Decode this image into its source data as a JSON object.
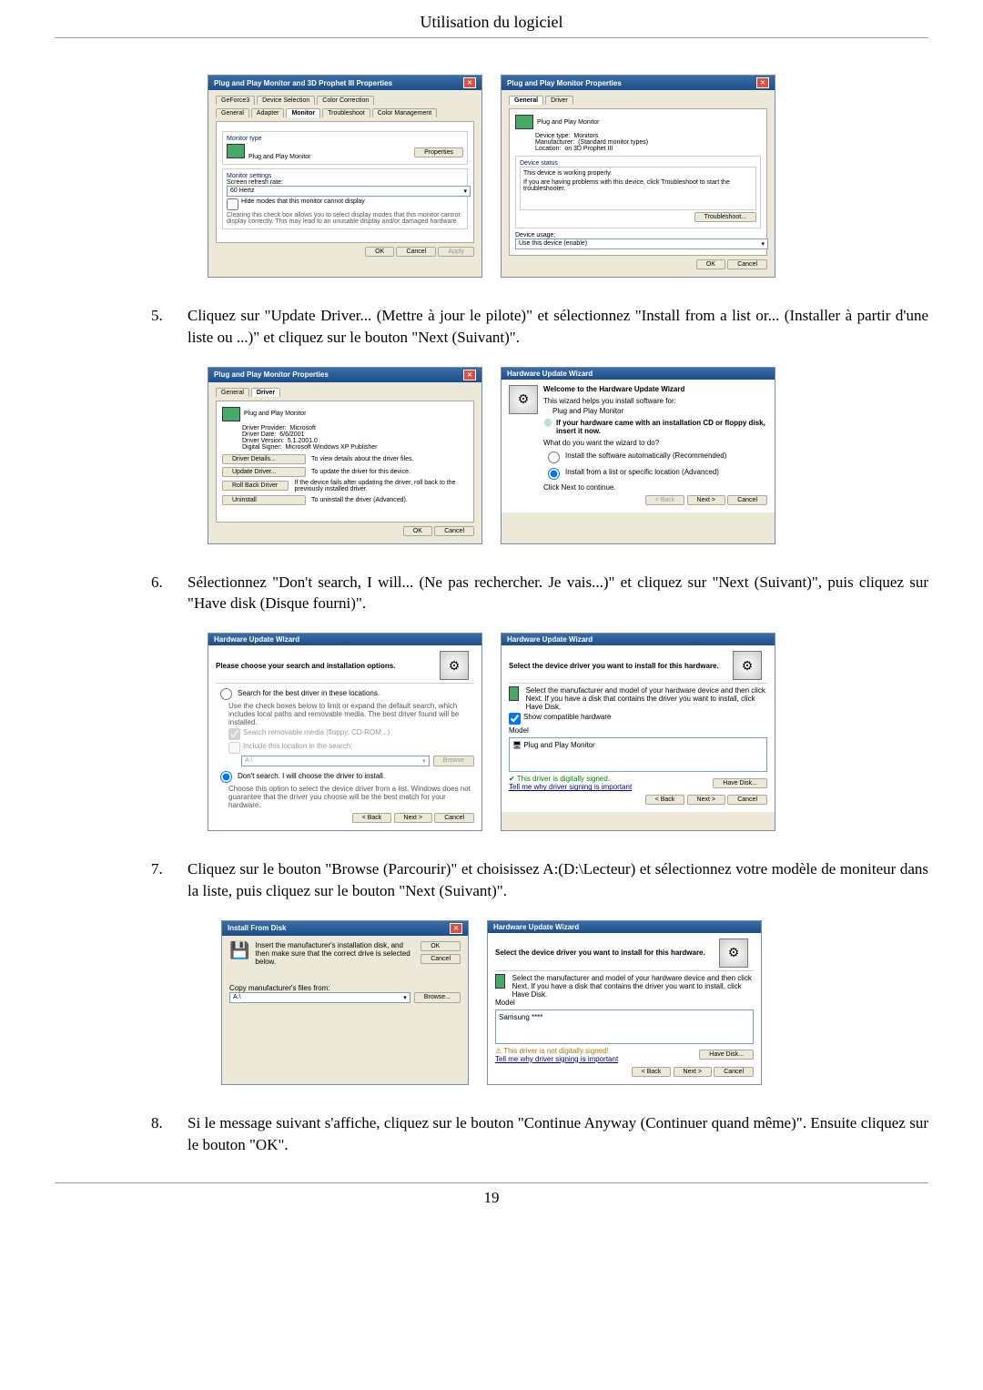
{
  "header": "Utilisation du logiciel",
  "page_number": "19",
  "steps": {
    "s5": {
      "num": "5.",
      "text": "Cliquez sur \"Update Driver... (Mettre à jour le pilote)\" et sélectionnez \"Install from a list or... (Installer à partir d'une liste ou ...)\" et cliquez sur le bouton \"Next (Suivant)\"."
    },
    "s6": {
      "num": "6.",
      "text": "Sélectionnez \"Don't search, I will... (Ne pas rechercher. Je vais...)\" et cliquez sur \"Next (Suivant)\", puis cliquez sur \"Have disk (Disque fourni)\"."
    },
    "s7": {
      "num": "7.",
      "text": "Cliquez sur le bouton \"Browse (Parcourir)\" et choisissez A:(D:\\Lecteur) et sélectionnez votre modèle de moniteur dans la liste, puis cliquez sur le bouton \"Next (Suivant)\"."
    },
    "s8": {
      "num": "8.",
      "text": "Si le message suivant s'affiche, cliquez sur le bouton \"Continue Anyway (Continuer quand même)\". Ensuite cliquez sur le bouton \"OK\"."
    }
  },
  "d1": {
    "title": "Plug and Play Monitor and 3D Prophet III Properties",
    "tabs": {
      "t1": "GeForce3",
      "t2": "Device Selection",
      "t3": "Color Correction",
      "t4": "General",
      "t5": "Adapter",
      "t6": "Monitor",
      "t7": "Troubleshoot",
      "t8": "Color Management"
    },
    "mon_type_lbl": "Monitor type",
    "mon_type": "Plug and Play Monitor",
    "prop_btn": "Properties",
    "mon_set_lbl": "Monitor settings",
    "refresh_lbl": "Screen refresh rate:",
    "refresh_val": "60 Hertz",
    "hide_modes": "Hide modes that this monitor cannot display",
    "hide_desc": "Clearing this check box allows you to select display modes that this monitor cannot display correctly. This may lead to an unusable display and/or damaged hardware.",
    "ok": "OK",
    "cancel": "Cancel",
    "apply": "Apply"
  },
  "d2": {
    "title": "Plug and Play Monitor Properties",
    "tabs": {
      "t1": "General",
      "t2": "Driver"
    },
    "name": "Plug and Play Monitor",
    "devtype_lbl": "Device type:",
    "devtype": "Monitors",
    "manuf_lbl": "Manufacturer:",
    "manuf": "(Standard monitor types)",
    "loc_lbl": "Location:",
    "loc": "on 3D Prophet III",
    "status_lbl": "Device status",
    "status_text": "This device is working properly.",
    "status_text2": "If you are having problems with this device, click Troubleshoot to start the troubleshooter.",
    "trouble_btn": "Troubleshoot...",
    "usage_lbl": "Device usage:",
    "usage_val": "Use this device (enable)",
    "ok": "OK",
    "cancel": "Cancel"
  },
  "d3": {
    "title": "Plug and Play Monitor Properties",
    "tabs": {
      "t1": "General",
      "t2": "Driver"
    },
    "name": "Plug and Play Monitor",
    "prov_lbl": "Driver Provider:",
    "prov": "Microsoft",
    "date_lbl": "Driver Date:",
    "date": "6/6/2001",
    "ver_lbl": "Driver Version:",
    "ver": "5.1.2001.0",
    "sign_lbl": "Digital Signer:",
    "sign": "Microsoft Windows XP Publisher",
    "details_btn": "Driver Details...",
    "details_desc": "To view details about the driver files.",
    "update_btn": "Update Driver...",
    "update_desc": "To update the driver for this device.",
    "roll_btn": "Roll Back Driver",
    "roll_desc": "If the device fails after updating the driver, roll back to the previously installed driver.",
    "unin_btn": "Uninstall",
    "unin_desc": "To uninstall the driver (Advanced).",
    "ok": "OK",
    "cancel": "Cancel"
  },
  "d4": {
    "title": "Hardware Update Wizard",
    "h1": "Welcome to the Hardware Update Wizard",
    "line1": "This wizard helps you install software for:",
    "line2": "Plug and Play Monitor",
    "cd_text": "If your hardware came with an installation CD or floppy disk, insert it now.",
    "q": "What do you want the wizard to do?",
    "opt1": "Install the software automatically (Recommended)",
    "opt2": "Install from a list or specific location (Advanced)",
    "cont": "Click Next to continue.",
    "back": "< Back",
    "next": "Next >",
    "cancel": "Cancel"
  },
  "d5": {
    "title": "Hardware Update Wizard",
    "h": "Please choose your search and installation options.",
    "opt1": "Search for the best driver in these locations.",
    "opt1_desc": "Use the check boxes below to limit or expand the default search, which includes local paths and removable media. The best driver found will be installed.",
    "cb1": "Search removable media (floppy, CD-ROM...)",
    "cb2": "Include this location in the search:",
    "path": "A:\\",
    "browse": "Browse",
    "opt2": "Don't search. I will choose the driver to install.",
    "opt2_desc": "Choose this option to select the device driver from a list. Windows does not guarantee that the driver you choose will be the best match for your hardware.",
    "back": "< Back",
    "next": "Next >",
    "cancel": "Cancel"
  },
  "d6": {
    "title": "Hardware Update Wizard",
    "h": "Select the device driver you want to install for this hardware.",
    "desc": "Select the manufacturer and model of your hardware device and then click Next. If you have a disk that contains the driver you want to install, click Have Disk.",
    "compat": "Show compatible hardware",
    "model_lbl": "Model",
    "model": "Plug and Play Monitor",
    "signed": "This driver is digitally signed.",
    "tell": "Tell me why driver signing is important",
    "have": "Have Disk...",
    "back": "< Back",
    "next": "Next >",
    "cancel": "Cancel"
  },
  "d7": {
    "title": "Install From Disk",
    "desc": "Insert the manufacturer's installation disk, and then make sure that the correct drive is selected below.",
    "ok": "OK",
    "cancel": "Cancel",
    "copy_lbl": "Copy manufacturer's files from:",
    "path": "A:\\",
    "browse": "Browse..."
  },
  "d8": {
    "title": "Hardware Update Wizard",
    "h": "Select the device driver you want to install for this hardware.",
    "desc": "Select the manufacturer and model of your hardware device and then click Next. If you have a disk that contains the driver you want to install, click Have Disk.",
    "model_lbl": "Model",
    "model": "Samsung ****",
    "not_signed": "This driver is not digitally signed!",
    "tell": "Tell me why driver signing is important",
    "have": "Have Disk...",
    "back": "< Back",
    "next": "Next >",
    "cancel": "Cancel"
  }
}
